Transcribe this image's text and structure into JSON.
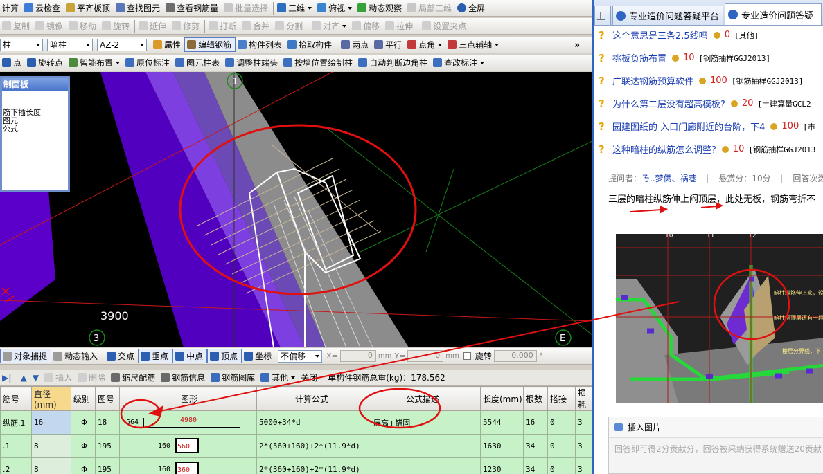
{
  "toolbar1": {
    "items": [
      "计算",
      "云检查",
      "平齐板顶",
      "查找图元",
      "查看钢筋量",
      "批量选择",
      "三维",
      "俯视",
      "动态观察",
      "局部三维",
      "全屏"
    ]
  },
  "toolbar2": {
    "items": [
      "复制",
      "镜像",
      "移动",
      "旋转",
      "延伸",
      "修剪",
      "打断",
      "合并",
      "分割",
      "对齐",
      "偏移",
      "拉伸",
      "设置夹点"
    ]
  },
  "toolbar3": {
    "combo1": "柱",
    "combo2": "暗柱",
    "combo3": "AZ-2",
    "items": [
      "属性",
      "编辑钢筋",
      "构件列表",
      "拾取构件",
      "两点",
      "平行",
      "点角",
      "三点辅轴"
    ],
    "more": "»"
  },
  "toolbar4": {
    "items": [
      "点",
      "旋转点",
      "智能布置",
      "原位标注",
      "图元柱表",
      "调整柱端头",
      "按墙位置绘制柱",
      "自动判断边角柱",
      "查改标注"
    ]
  },
  "panel": {
    "title": "属性面板",
    "title_visible": "制面板",
    "lines": [
      "筋下插长度",
      "图元",
      "公式"
    ]
  },
  "view": {
    "axis_1": "1",
    "axis_3": "3",
    "axis_e": "E",
    "dimension": "3900"
  },
  "snapbar": {
    "items": [
      "对象捕捉",
      "动态输入",
      "交点",
      "垂点",
      "中点",
      "顶点",
      "坐标"
    ],
    "offset_mode": "不偏移",
    "x_label": "X=",
    "x_value": "0",
    "y_label": "Y=",
    "y_value": "0",
    "unit": "mm",
    "rotate_label": "旋转",
    "rotate_value": "0.000",
    "degree": "°"
  },
  "gridbar": {
    "items": [
      "插入",
      "删除",
      "缩尺配筋",
      "钢筋信息",
      "钢筋图库",
      "其他",
      "关闭"
    ],
    "total": "单构件钢筋总重(kg)：178.562"
  },
  "grid": {
    "headers": [
      "筋号",
      "直径(mm)",
      "级别",
      "图号",
      "图形",
      "计算公式",
      "公式描述",
      "长度(mm)",
      "根数",
      "搭接",
      "损耗"
    ],
    "rows": [
      {
        "name": "纵筋.1",
        "dia": "16",
        "grade": "Φ",
        "fig": "18",
        "shape_a": "564",
        "shape_b": "4980",
        "formula": "5000+34*d",
        "desc": "层高+锚固",
        "len": "5544",
        "count": "16",
        "lap": "0",
        "loss": "3"
      },
      {
        "name": ".1",
        "dia": "8",
        "grade": "Φ",
        "fig": "195",
        "shape_a": "160",
        "shape_b": "560",
        "formula": "2*(560+160)+2*(11.9*d)",
        "desc": "",
        "len": "1630",
        "count": "34",
        "lap": "0",
        "loss": "3"
      },
      {
        "name": ".2",
        "dia": "8",
        "grade": "Φ",
        "fig": "195",
        "shape_a": "160",
        "shape_b": "360",
        "formula": "2*(360+160)+2*(11.9*d)",
        "desc": "",
        "len": "1230",
        "count": "34",
        "lap": "0",
        "loss": "3"
      }
    ]
  },
  "browser": {
    "tab0": "上",
    "tab1": "专业造价问题答疑平台",
    "tab2": "专业造价问题答疑"
  },
  "questions": [
    {
      "title": "这个意思是三条2.5线吗",
      "score": "0",
      "cat": "[其他]"
    },
    {
      "title": "挑板负筋布置",
      "score": "10",
      "cat": "[钢筋抽样GGJ2013]"
    },
    {
      "title": "广联达钢筋预算软件",
      "score": "100",
      "cat": "[钢筋抽样GGJ2013]"
    },
    {
      "title": "为什么第二层没有超高模板?",
      "score": "20",
      "cat": "[土建算量GCL2"
    },
    {
      "title": "园建图纸的 入口门廊附近的台阶，下4",
      "score": "100",
      "cat": "[市"
    },
    {
      "title": "这种暗柱的纵筋怎么调整?",
      "score": "10",
      "cat": "[钢筋抽样GGJ2013"
    }
  ],
  "meta": {
    "asker_label": "提问者：",
    "asker": "ㄋ..梦俩、祸巷",
    "bounty": "悬赏分：10分",
    "answers": "回答次数"
  },
  "question_text": "三层的暗柱纵筋伸上闷顶层，此处无板，钢筋弯折不",
  "shot": {
    "a1": "10",
    "a2": "11",
    "a3": "12",
    "note1": "暗柱纵筋伸上来，设",
    "note2": "暗柱闷顶层还有一段",
    "note3": "楼层分界线，下"
  },
  "answer": {
    "insert_image": "插入图片",
    "placeholder": "回答即可得2分贡献分，回答被采纳获得系统赠送20贡献"
  },
  "colors": {
    "accent": "#2f66c2",
    "grid_row": "#c7f2c7",
    "annot": "#e01010"
  }
}
